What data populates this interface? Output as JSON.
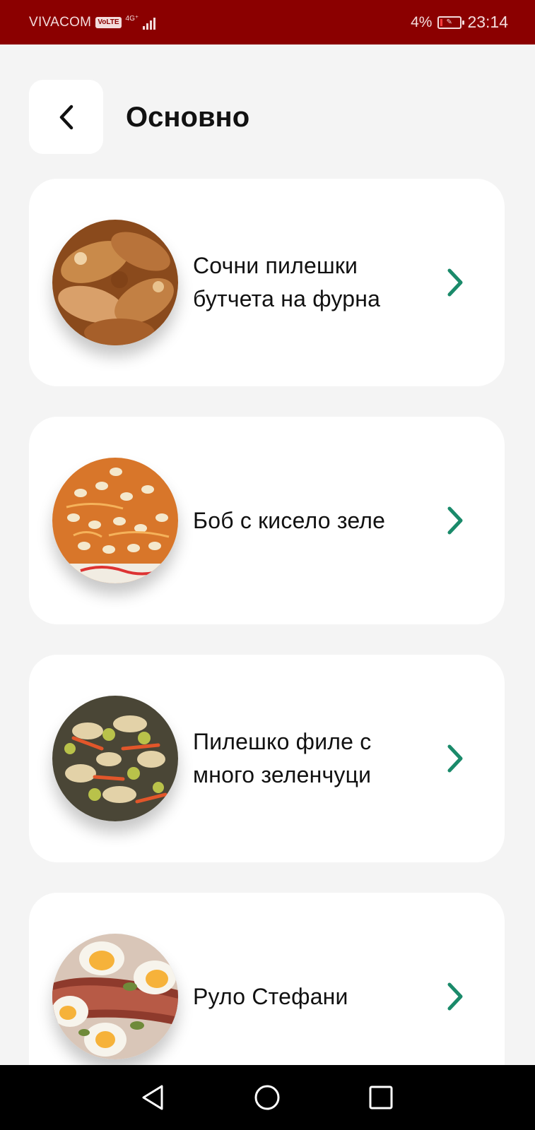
{
  "status_bar": {
    "carrier": "VIVACOM",
    "volte_badge": "VoLTE",
    "network_type": "4G⁺",
    "signal_icon": "cellular-signal-icon",
    "battery_percent": "4%",
    "battery_icon": "battery-low-icon",
    "time": "23:14",
    "background_color": "#8b0000"
  },
  "header": {
    "back_icon": "chevron-left-icon",
    "title": "Основно"
  },
  "recipes": [
    {
      "name": "Сочни пилешки бутчета на фурна",
      "thumbnail": "roasted chicken drumsticks"
    },
    {
      "name": "Боб с кисело зеле",
      "thumbnail": "beans with sauerkraut"
    },
    {
      "name": "Пилешко филе с много зеленчуци",
      "thumbnail": "chicken fillet with vegetables"
    },
    {
      "name": "Руло Стефани",
      "thumbnail": "meatloaf with eggs and pickles"
    }
  ],
  "accent_color": "#1a8a6a",
  "chevron_icon": "chevron-right-icon",
  "nav_bar": {
    "back_icon": "triangle-back-icon",
    "home_icon": "circle-home-icon",
    "recents_icon": "square-recents-icon"
  }
}
